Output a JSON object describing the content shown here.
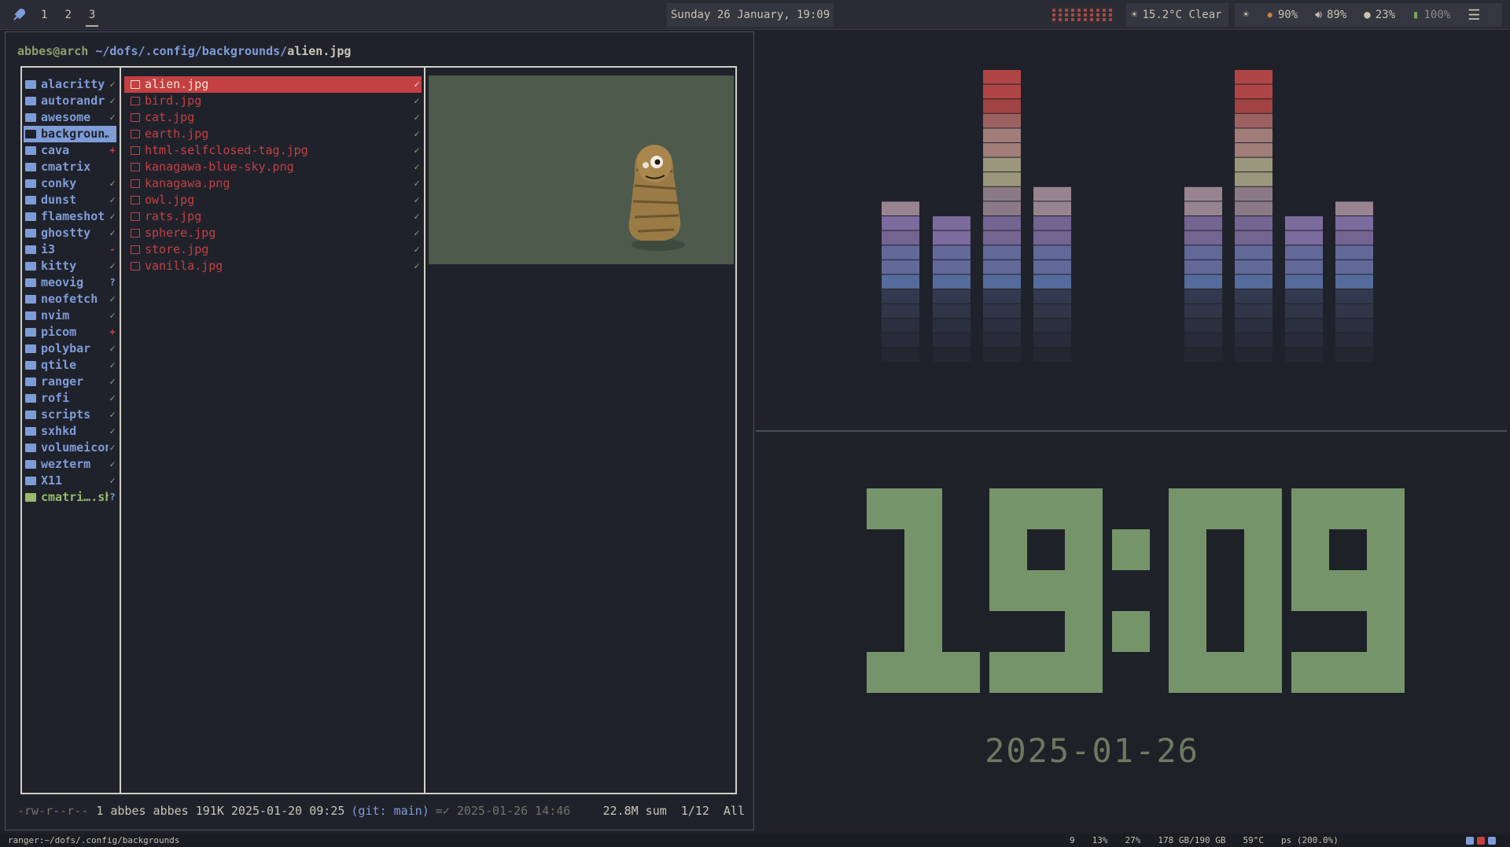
{
  "topbar": {
    "workspaces": [
      "1",
      "2",
      "3"
    ],
    "active_workspace": "3",
    "datetime": "Sunday 26 January, 19:09",
    "weather": "15.2°C Clear",
    "brightness_icon": "sun-icon",
    "cpu": "90%",
    "volume": "89%",
    "mic": "23%",
    "battery": "100%",
    "launcher_icon": "rocket-icon",
    "menu_icon": "menu-icon"
  },
  "ranger": {
    "user": "abbes@arch",
    "path": "~/dofs/.config/backgrounds/",
    "file": "alien.jpg",
    "dirs": [
      {
        "name": "alacritty",
        "status": "✓"
      },
      {
        "name": "autorandr",
        "status": "✓"
      },
      {
        "name": "awesome",
        "status": "✓"
      },
      {
        "name": "backgroun…",
        "status": "✓",
        "selected": true
      },
      {
        "name": "cava",
        "status": "+"
      },
      {
        "name": "cmatrix",
        "status": ""
      },
      {
        "name": "conky",
        "status": "✓"
      },
      {
        "name": "dunst",
        "status": "✓"
      },
      {
        "name": "flameshot",
        "status": "✓"
      },
      {
        "name": "ghostty",
        "status": "✓"
      },
      {
        "name": "i3",
        "status": "-"
      },
      {
        "name": "kitty",
        "status": "✓"
      },
      {
        "name": "meovig",
        "status": "?"
      },
      {
        "name": "neofetch",
        "status": "✓"
      },
      {
        "name": "nvim",
        "status": "✓"
      },
      {
        "name": "picom",
        "status": "+"
      },
      {
        "name": "polybar",
        "status": "✓"
      },
      {
        "name": "qtile",
        "status": "✓"
      },
      {
        "name": "ranger",
        "status": "✓"
      },
      {
        "name": "rofi",
        "status": "✓"
      },
      {
        "name": "scripts",
        "status": "✓"
      },
      {
        "name": "sxhkd",
        "status": "✓"
      },
      {
        "name": "volumeicon",
        "status": "✓"
      },
      {
        "name": "wezterm",
        "status": "✓"
      },
      {
        "name": "X11",
        "status": "✓"
      },
      {
        "name": "cmatri….sh",
        "status": "?",
        "script": true
      }
    ],
    "files": [
      {
        "name": "alien.jpg",
        "selected": true
      },
      {
        "name": "bird.jpg"
      },
      {
        "name": "cat.jpg"
      },
      {
        "name": "earth.jpg"
      },
      {
        "name": "html-selfclosed-tag.jpg"
      },
      {
        "name": "kanagawa-blue-sky.png"
      },
      {
        "name": "kanagawa.png"
      },
      {
        "name": "owl.jpg"
      },
      {
        "name": "rats.jpg"
      },
      {
        "name": "sphere.jpg"
      },
      {
        "name": "store.jpg"
      },
      {
        "name": "vanilla.jpg"
      }
    ],
    "status": {
      "perms": "-rw-r--r--",
      "info": "1 abbes abbes 191K 2025-01-20 09:25",
      "git": "(git: main)",
      "changed": "=✓ 2025-01-26 14:46",
      "sum": "22.8M sum",
      "position": "1/12",
      "scope": "All"
    }
  },
  "visualizer": {
    "bars": [
      0.42,
      0.31,
      1.0,
      0.45,
      0.45,
      1.0,
      0.31,
      0.42
    ],
    "colors": [
      "#5f78b0",
      "#7a6aa0",
      "#a89a96",
      "#b3ab8e",
      "#b47c7c",
      "#b84848"
    ]
  },
  "clock": {
    "time": "19:09",
    "date": "2025-01-26",
    "digit_color": "#76946a"
  },
  "bottombar": {
    "left": "ranger:~/dofs/.config/backgrounds",
    "stats": [
      "9",
      "13%",
      "27%",
      "178 GB/190 GB",
      "59°C",
      "ps (200.0%)"
    ]
  }
}
